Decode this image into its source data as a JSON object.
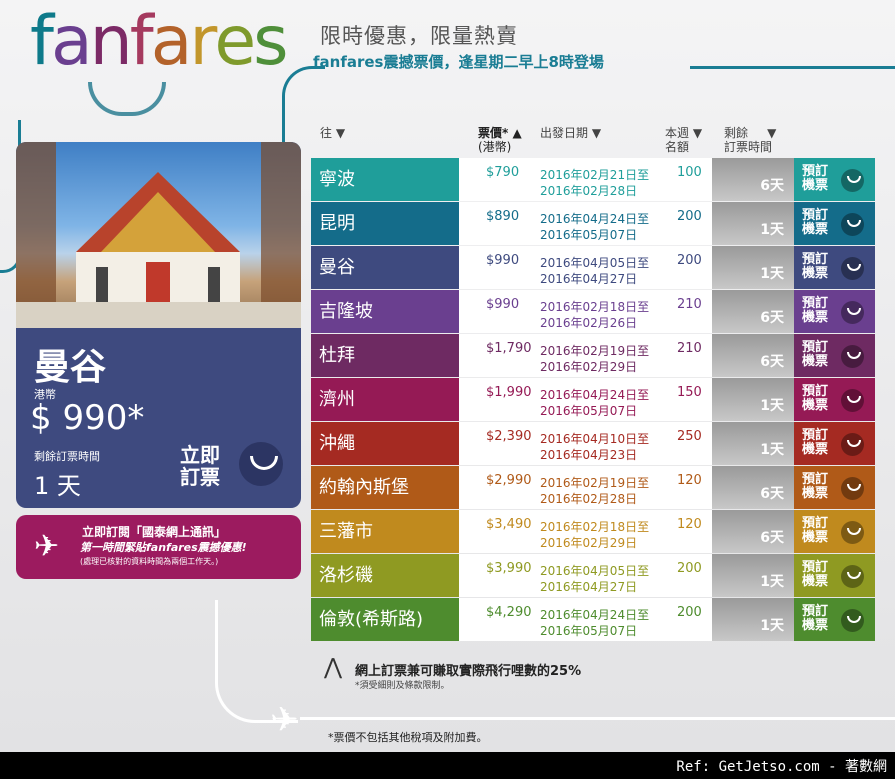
{
  "brand": {
    "letters": [
      {
        "ch": "f",
        "color": "#0e7a8a"
      },
      {
        "ch": "a",
        "color": "#6a3f8f"
      },
      {
        "ch": "n",
        "color": "#7c2a66"
      },
      {
        "ch": "f",
        "color": "#a53a5f"
      },
      {
        "ch": "a",
        "color": "#b3622a"
      },
      {
        "ch": "r",
        "color": "#c2962b"
      },
      {
        "ch": "e",
        "color": "#7f9a2c"
      },
      {
        "ch": "s",
        "color": "#4f8f3a"
      }
    ]
  },
  "header": {
    "line1": "限時優惠，限量熱賣",
    "line2": "fanfares震撼票價，逢星期二早上8時登場"
  },
  "card": {
    "city": "曼谷",
    "currency": "港幣",
    "price": "$ 990*",
    "remain_label": "剩餘訂票時間",
    "remain_value": "1 天",
    "book_label": "立即訂票"
  },
  "promo": {
    "line1": "立即訂閱「國泰網上通訊」",
    "line2": "第一時間緊貼fanfares震撼優惠!",
    "line3": "(處理已核對的資料時間為兩個工作天。)"
  },
  "columns": {
    "dest": "往 ▼",
    "price": "票價* ▲",
    "price_sub": "(港幣)",
    "date": "出發日期 ▼",
    "seats": "本週 ▼",
    "seats_sub": "名額",
    "remain": "剩餘     ▼",
    "remain_sub": "訂票時間"
  },
  "book_label": "預訂機票",
  "rows": [
    {
      "city": "寧波",
      "price": "$790",
      "d1": "2016年02月21日至",
      "d2": "2016年02月28日",
      "seats": "100",
      "remain": "6天",
      "color": "#1f9e9a"
    },
    {
      "city": "昆明",
      "price": "$890",
      "d1": "2016年04月24日至",
      "d2": "2016年05月07日",
      "seats": "200",
      "remain": "1天",
      "color": "#146c8a"
    },
    {
      "city": "曼谷",
      "price": "$990",
      "d1": "2016年04月05日至",
      "d2": "2016年04月27日",
      "seats": "200",
      "remain": "1天",
      "color": "#3e4a7f"
    },
    {
      "city": "吉隆坡",
      "price": "$990",
      "d1": "2016年02月18日至",
      "d2": "2016年02月26日",
      "seats": "210",
      "remain": "6天",
      "color": "#6a3f8f"
    },
    {
      "city": "杜拜",
      "price": "$1,790",
      "d1": "2016年02月19日至",
      "d2": "2016年02月29日",
      "seats": "210",
      "remain": "6天",
      "color": "#6e2a62"
    },
    {
      "city": "濟州",
      "price": "$1,990",
      "d1": "2016年04月24日至",
      "d2": "2016年05月07日",
      "seats": "150",
      "remain": "1天",
      "color": "#951a55"
    },
    {
      "city": "沖繩",
      "price": "$2,390",
      "d1": "2016年04月10日至",
      "d2": "2016年04月23日",
      "seats": "250",
      "remain": "1天",
      "color": "#a52a22"
    },
    {
      "city": "約翰內斯堡",
      "price": "$2,990",
      "d1": "2016年02月19日至",
      "d2": "2016年02月28日",
      "seats": "120",
      "remain": "6天",
      "color": "#b05a18"
    },
    {
      "city": "三藩市",
      "price": "$3,490",
      "d1": "2016年02月18日至",
      "d2": "2016年02月29日",
      "seats": "120",
      "remain": "6天",
      "color": "#c08a1e"
    },
    {
      "city": "洛杉磯",
      "price": "$3,990",
      "d1": "2016年04月05日至",
      "d2": "2016年04月27日",
      "seats": "200",
      "remain": "1天",
      "color": "#8f9a22"
    },
    {
      "city": "倫敦(希斯路)",
      "price": "$4,290",
      "d1": "2016年04月24日至",
      "d2": "2016年05月07日",
      "seats": "200",
      "remain": "1天",
      "color": "#4e8c2e"
    }
  ],
  "notes": {
    "miles": "網上訂票兼可賺取實際飛行哩數的25%",
    "terms": "*須受細則及條款限制。",
    "footer": "*票價不包括其他稅項及附加費。"
  },
  "watermark": "Ref: GetJetso.com - 著數網"
}
